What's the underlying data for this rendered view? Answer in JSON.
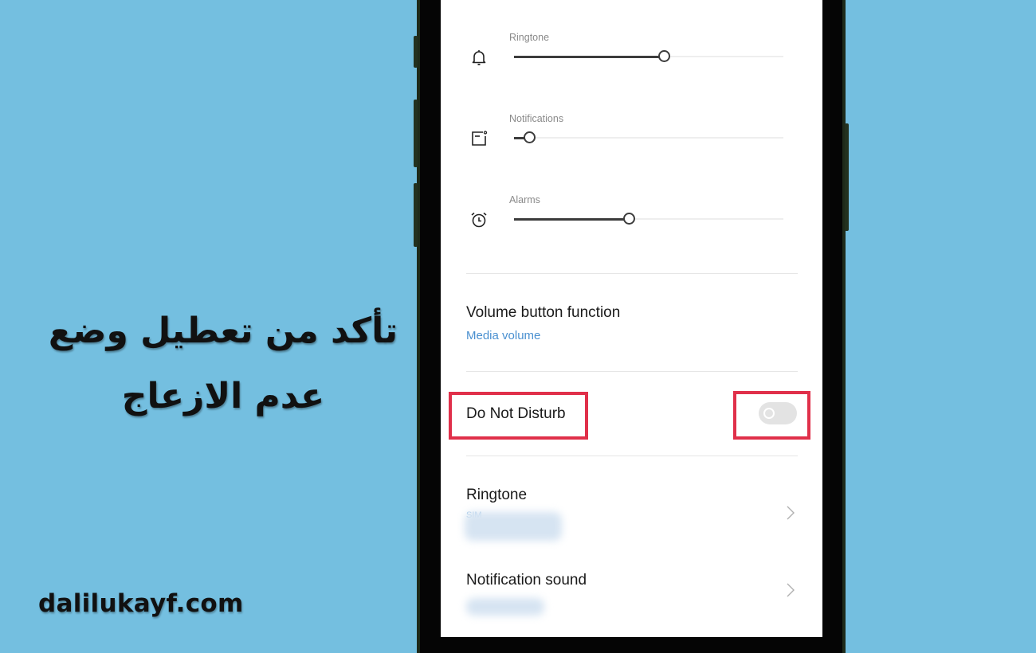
{
  "caption": {
    "line1": "تأكد من تعطيل وضع",
    "line2": "عدم الازعاج"
  },
  "watermark": "dalilukayf.com",
  "colors": {
    "background": "#74bfe0",
    "highlight": "#e0304a",
    "link": "#4a90d0"
  },
  "volume": {
    "sliders": [
      {
        "label": "Ringtone",
        "icon": "bell-icon",
        "level_percent": 56
      },
      {
        "label": "Notifications",
        "icon": "notification-icon",
        "level_percent": 6
      },
      {
        "label": "Alarms",
        "icon": "alarm-clock-icon",
        "level_percent": 43
      }
    ]
  },
  "settings": {
    "volume_button": {
      "title": "Volume button function",
      "value": "Media volume"
    },
    "dnd": {
      "title": "Do Not Disturb",
      "enabled": false
    },
    "ringtone": {
      "title": "Ringtone",
      "value": "SIM"
    },
    "notification_sound": {
      "title": "Notification sound"
    }
  }
}
